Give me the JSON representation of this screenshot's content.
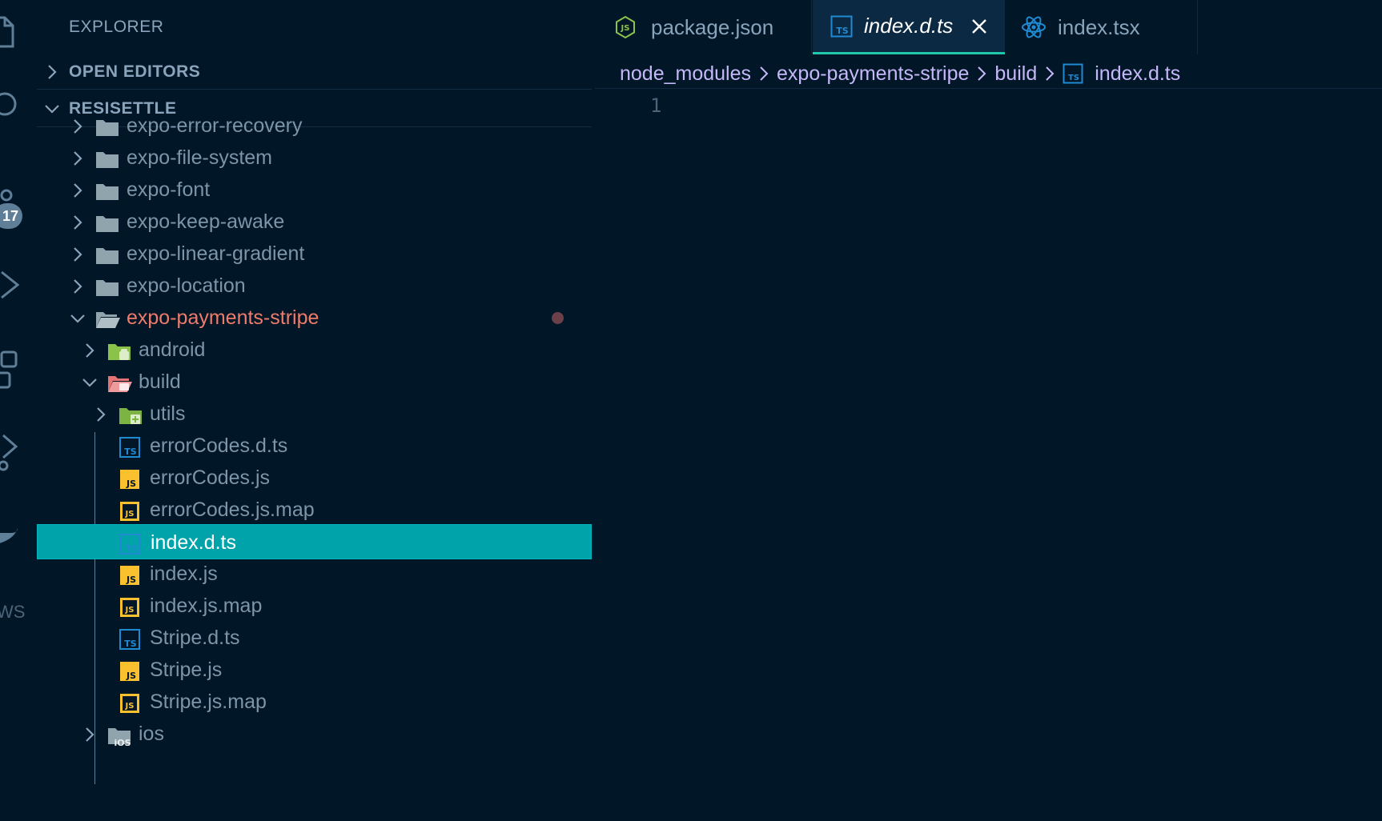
{
  "explorer": {
    "title": "EXPLORER",
    "open_editors": "OPEN EDITORS",
    "project": "RESISETTLE"
  },
  "activity": {
    "badge": "17",
    "aws": "WS"
  },
  "tree": [
    {
      "name": "expo-error-recovery",
      "kind": "folder",
      "depth": 0,
      "state": "closed"
    },
    {
      "name": "expo-file-system",
      "kind": "folder",
      "depth": 0,
      "state": "closed"
    },
    {
      "name": "expo-font",
      "kind": "folder",
      "depth": 0,
      "state": "closed"
    },
    {
      "name": "expo-keep-awake",
      "kind": "folder",
      "depth": 0,
      "state": "closed"
    },
    {
      "name": "expo-linear-gradient",
      "kind": "folder",
      "depth": 0,
      "state": "closed"
    },
    {
      "name": "expo-location",
      "kind": "folder",
      "depth": 0,
      "state": "closed"
    },
    {
      "name": "expo-payments-stripe",
      "kind": "folder-open",
      "depth": 0,
      "state": "open",
      "modified": true
    },
    {
      "name": "android",
      "kind": "folder-android",
      "depth": 1,
      "state": "closed"
    },
    {
      "name": "build",
      "kind": "folder-build",
      "depth": 1,
      "state": "open"
    },
    {
      "name": "utils",
      "kind": "folder-utils",
      "depth": 2,
      "state": "closed"
    },
    {
      "name": "errorCodes.d.ts",
      "kind": "ts",
      "depth": 2
    },
    {
      "name": "errorCodes.js",
      "kind": "js",
      "depth": 2
    },
    {
      "name": "errorCodes.js.map",
      "kind": "jsmap",
      "depth": 2
    },
    {
      "name": "index.d.ts",
      "kind": "ts",
      "depth": 2,
      "selected": true
    },
    {
      "name": "index.js",
      "kind": "js",
      "depth": 2
    },
    {
      "name": "index.js.map",
      "kind": "jsmap",
      "depth": 2
    },
    {
      "name": "Stripe.d.ts",
      "kind": "ts",
      "depth": 2
    },
    {
      "name": "Stripe.js",
      "kind": "js",
      "depth": 2
    },
    {
      "name": "Stripe.js.map",
      "kind": "jsmap",
      "depth": 2
    },
    {
      "name": "ios",
      "kind": "folder-ios",
      "depth": 1,
      "state": "closed"
    }
  ],
  "tabs": [
    {
      "label": "package.json",
      "icon": "nodejs-icon"
    },
    {
      "label": "index.d.ts",
      "icon": "typescript-icon",
      "active": true
    },
    {
      "label": "index.tsx",
      "icon": "react-icon"
    }
  ],
  "breadcrumb": [
    "node_modules",
    "expo-payments-stripe",
    "build",
    "index.d.ts"
  ],
  "editor": {
    "line_number": "1"
  },
  "colors": {
    "accent": "#00a3a9",
    "modified": "#ef7c6b",
    "bg": "#011627",
    "breadcrumb": "#c5b8f8"
  }
}
